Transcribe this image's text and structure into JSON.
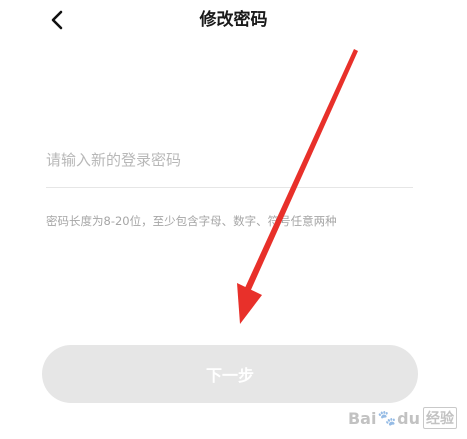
{
  "header": {
    "back_icon": "chevron-left-icon",
    "title": "修改密码"
  },
  "form": {
    "password_placeholder": "请输入新的登录密码",
    "password_value": "",
    "hint": "密码长度为8-20位，至少包含字母、数字、符号任意两种"
  },
  "actions": {
    "next_label": "下一步",
    "next_enabled": false
  },
  "annotation": {
    "arrow_color": "#e8302a"
  },
  "watermark": {
    "text_left": "Bai",
    "text_right": "du",
    "suffix": "经验"
  },
  "colors": {
    "button_disabled_bg": "#e6e6e6",
    "hint_text": "#a6a6a6",
    "placeholder_text": "#b8b8b8"
  }
}
